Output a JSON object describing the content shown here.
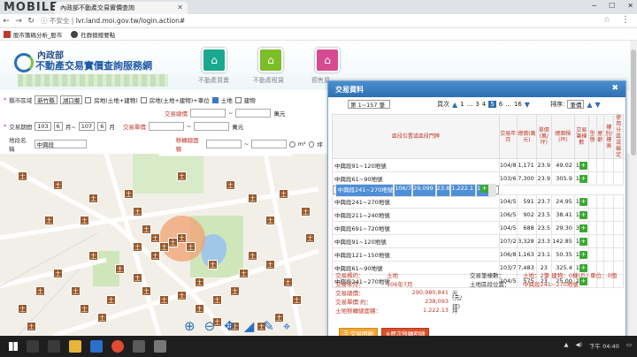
{
  "browser": {
    "watermark": "MOBILE01",
    "tab_title": "內政部不動產交易實價查詢",
    "url_prefix": "不安全",
    "url": "lvr.land.moi.gov.tw/login.action#",
    "bookmarks": [
      {
        "label": "股市籌碼分析_股市"
      },
      {
        "label": "社群擅搜要點"
      }
    ]
  },
  "site": {
    "logo_line1": "內政部",
    "logo_line2": "不動產交易實價查詢服務網",
    "nav": [
      {
        "label": "不動產買賣",
        "color": "#1aa88e"
      },
      {
        "label": "不動產租賃",
        "color": "#7cbd28"
      },
      {
        "label": "預售屋",
        "color": "#d64a8f"
      }
    ]
  },
  "search": {
    "city_label": "縣市區域",
    "city_value": "新竹縣",
    "district_value": "湖口鄉",
    "type_house_land": "房地(土地+建物)",
    "type_house_land_parking": "房地(土地+建物)+車位",
    "type_land": "土地",
    "type_building": "建物",
    "price_total_label": "交易總價",
    "price_unit_label": "交易單價",
    "area_label": "移轉總面積",
    "wan": "萬元",
    "period_label": "交易期間",
    "from_year": "103",
    "from_month": "6",
    "month_word": "月~",
    "to_year": "107",
    "to_month": "6",
    "month_end": "月",
    "road_label": "地段名稱",
    "road_value": "中興段",
    "unit_m2": "m²",
    "unit_ping": "坪"
  },
  "popup": {
    "title": "交易資料",
    "page_select": "第 1~157 筆",
    "pager_label": "頁次",
    "pages": [
      "1",
      "...",
      "3",
      "4",
      "5",
      "6",
      "...",
      "16"
    ],
    "current_page": "5",
    "sort_label": "排序:",
    "sort_value": "筆價",
    "columns": [
      "區段位置或區段門牌",
      "交易年月",
      "總價(萬元)",
      "單價(萬/坪)",
      "總面積(坪)",
      "交易筆棟數",
      "型態",
      "屋齡",
      "樓別/樓高",
      "使用分區或編定"
    ],
    "rows": [
      {
        "addr": "中興段91~120地號",
        "ym": "104/8",
        "total": "1,171",
        "unit": "23.9",
        "area": "49.02",
        "n": "1"
      },
      {
        "addr": "中興段61~90地號",
        "ym": "103/6",
        "total": "7,300",
        "unit": "23.9",
        "area": "305.9",
        "n": "1"
      },
      {
        "addr": "中興段241~270地號",
        "ym": "106/7",
        "total": "29,099",
        "unit": "23.8",
        "area": "1,222.1",
        "n": "1",
        "selected": true
      },
      {
        "addr": "中興段241~270地號",
        "ym": "104/5",
        "total": "591",
        "unit": "23.7",
        "area": "24.95",
        "n": "1"
      },
      {
        "addr": "中興段211~240地號",
        "ym": "106/5",
        "total": "902",
        "unit": "23.5",
        "area": "38.41",
        "n": "1"
      },
      {
        "addr": "中興段691~720地號",
        "ym": "104/5",
        "total": "688",
        "unit": "23.5",
        "area": "29.30",
        "n": "3"
      },
      {
        "addr": "中興段91~120地號",
        "ym": "107/2",
        "total": "3,328",
        "unit": "23.3",
        "area": "142.85",
        "n": "1"
      },
      {
        "addr": "中興段121~150地號",
        "ym": "106/8",
        "total": "1,163",
        "unit": "23.1",
        "area": "50.35",
        "n": "1"
      },
      {
        "addr": "中興段61~90地號",
        "ym": "103/7",
        "total": "7,483",
        "unit": "23",
        "area": "325.4",
        "n": "1"
      },
      {
        "addr": "中興段241~270地號",
        "ym": "104/5",
        "total": "575",
        "unit": "23",
        "area": "25.00",
        "n": "2"
      }
    ],
    "detail": {
      "target_k": "交易標的：",
      "target_v": "土地",
      "ym_k": "交易年月：",
      "ym_v": "106年7月",
      "total_k": "交易總價：",
      "total_v": "290,980,841",
      "total_u": "元",
      "unit_k": "交易單價 約：",
      "unit_v": "238,093",
      "unit_u": "(元/坪)",
      "area_k": "土地移轉總面積：",
      "area_v": "1,222.13",
      "area_u": "坪",
      "count_k": "交易筆棟數：",
      "count_v": "土地：2筆 建物：0棟(戶) 車位：0個",
      "loc_k": "土地區段位置：",
      "loc_v": "中興段241~270地號"
    },
    "btn_detail": "交易明細",
    "btn_history": "※歷次移轉明細"
  },
  "taskbar": {
    "time": "下午 04:40"
  }
}
